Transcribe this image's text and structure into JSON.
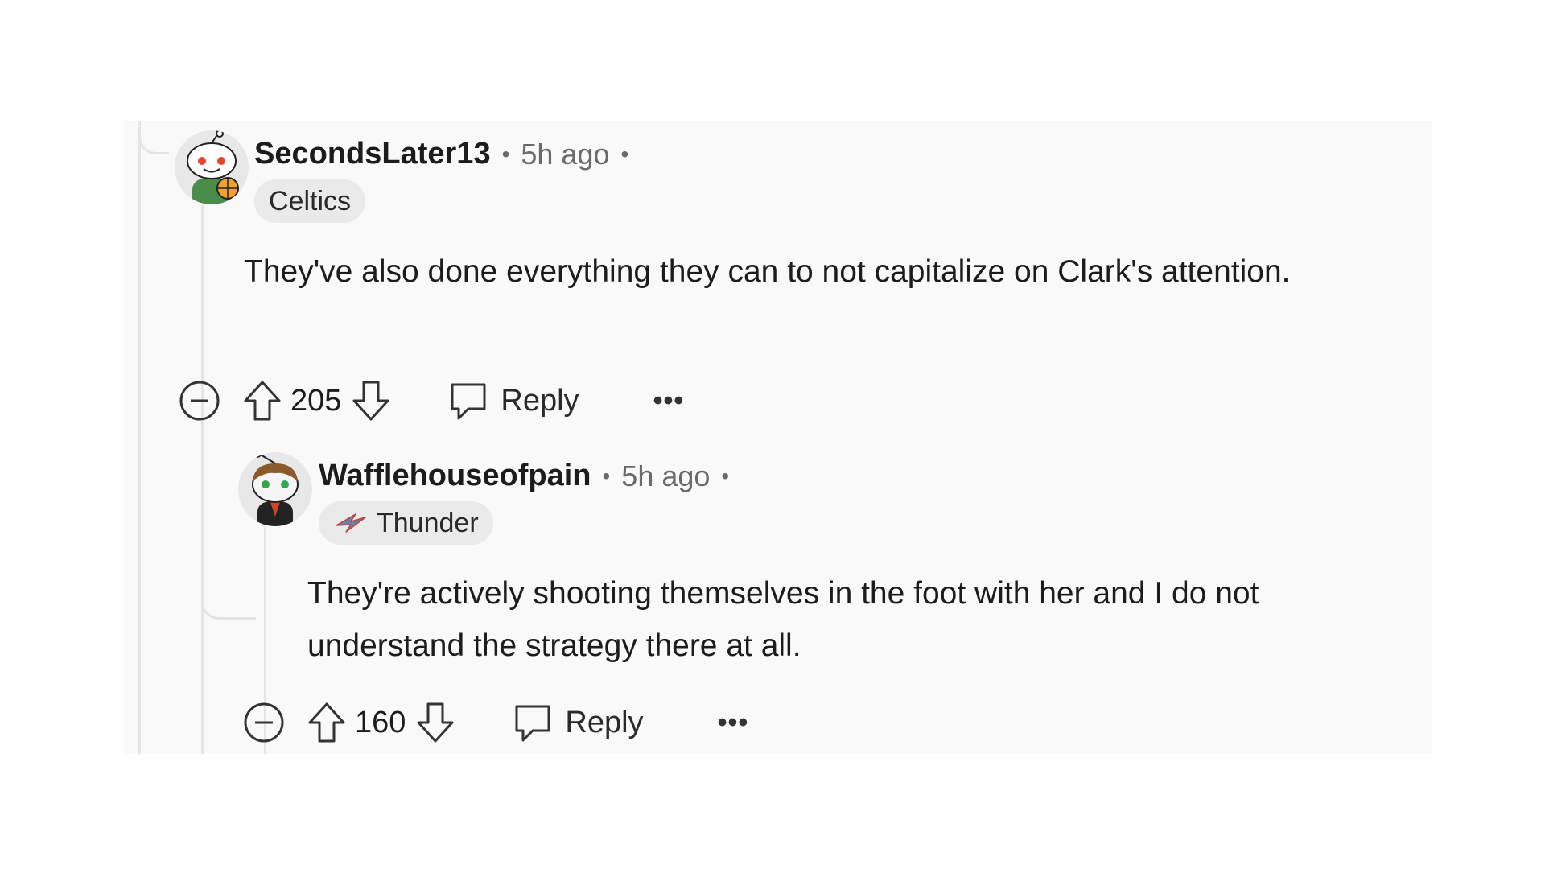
{
  "comments": [
    {
      "username": "SecondsLater13",
      "time": "5h ago",
      "separator": "•",
      "flair": "Celtics",
      "body": "They've also done everything they can to not capitalize on Clark's attention.",
      "score": "205",
      "reply_label": "Reply",
      "more_label": "•••",
      "avatar_icon": "reddit-snoo-basketball-avatar"
    },
    {
      "username": "Wafflehouseofpain",
      "time": "5h ago",
      "separator": "•",
      "flair": "Thunder",
      "flair_icon": "thunder-logo-icon",
      "body": "They're actively shooting themselves in the foot with her and I do not understand the strategy there at all.",
      "score": "160",
      "reply_label": "Reply",
      "more_label": "•••",
      "avatar_icon": "reddit-snoo-bearded-avatar"
    }
  ],
  "colors": {
    "panel_bg": "#f9f9f9",
    "thread_line": "#e5e5e5",
    "flair_bg": "#eaeaea",
    "meta_text": "#6a6a6a"
  }
}
